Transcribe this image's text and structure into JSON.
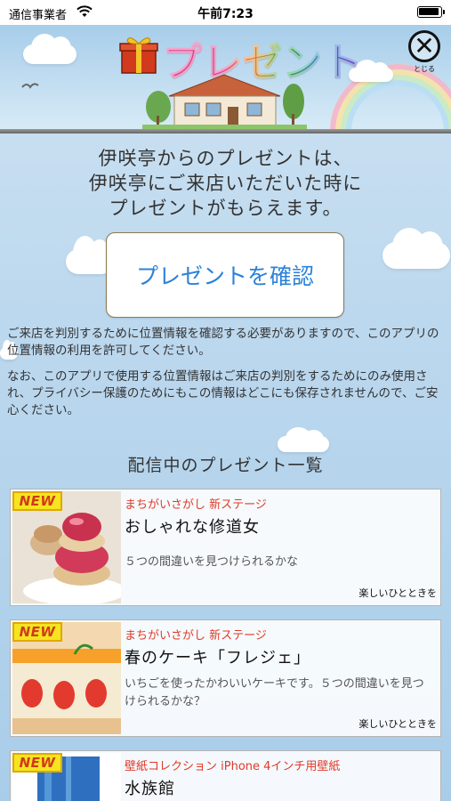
{
  "status_bar": {
    "carrier": "通信事業者",
    "time": "午前7:23"
  },
  "header": {
    "title": "プレゼント",
    "close_label": "とじる"
  },
  "intro": {
    "line1": "伊咲亭からのプレゼントは、",
    "line2": "伊咲亭にご来店いただいた時に",
    "line3": "プレゼントがもらえます。"
  },
  "confirm_button": {
    "label": "プレゼントを確認"
  },
  "notice": {
    "p1": "ご来店を判別するために位置情報を確認する必要がありますので、このアプリの位置情報の利用を許可してください。",
    "p2": "なお、このアプリで使用する位置情報はご来店の判別をするためにのみ使用され、プライバシー保護のためにもこの情報はどこにも保存されませんので、ご安心ください。"
  },
  "list_title": "配信中のプレゼント一覧",
  "presents": [
    {
      "badge": "NEW",
      "category": "まちがいさがし 新ステージ",
      "title": "おしゃれな修道女",
      "description": "５つの間違いを見つけられるかな",
      "footer": "楽しいひとときを"
    },
    {
      "badge": "NEW",
      "category": "まちがいさがし 新ステージ",
      "title": "春のケーキ「フレジェ」",
      "description": "いちごを使ったかわいいケーキです。５つの間違いを見つけられるかな？",
      "footer": "楽しいひとときを"
    },
    {
      "badge": "NEW",
      "category": "壁紙コレクション iPhone 4インチ用壁紙",
      "title": "水族館",
      "description": "",
      "footer": ""
    }
  ],
  "colors": {
    "accent": "#2b82d9",
    "category": "#e03a28",
    "badge": "#f5e41f"
  }
}
